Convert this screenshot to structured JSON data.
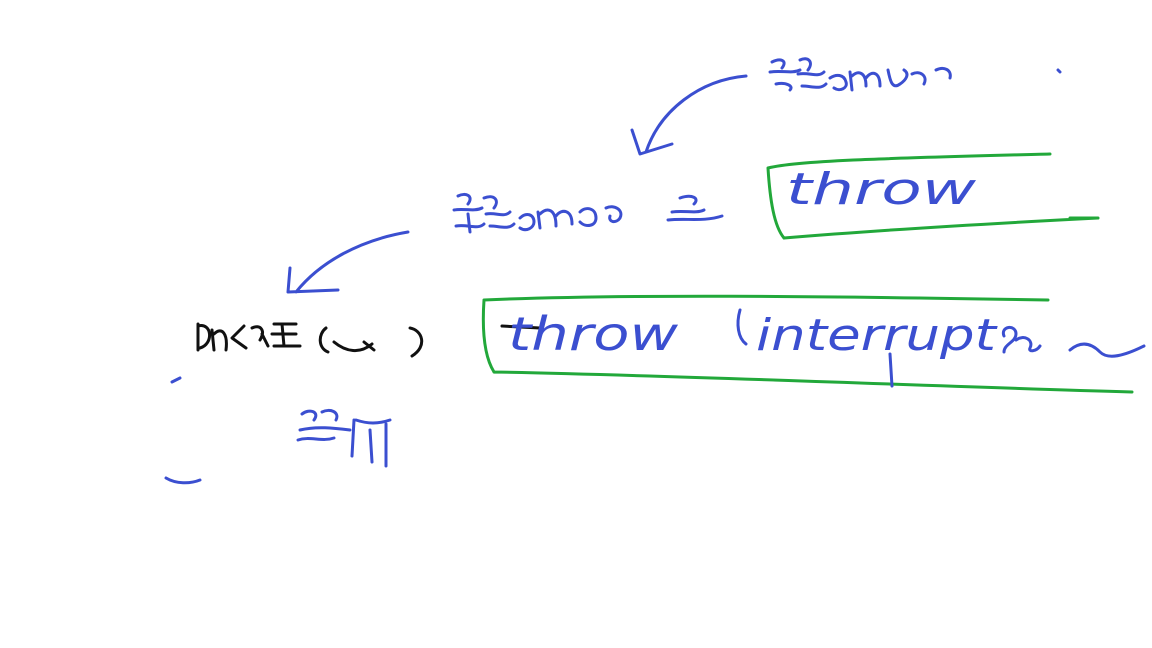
{
  "colors": {
    "blue_ink": "#3b4fd0",
    "green_ink": "#22a83a",
    "black_ink": "#111111",
    "background": "#ffffff"
  },
  "notes": {
    "scribble_top": "",
    "scribble_middle": "",
    "scribble_left": "",
    "scribble_bottom": "",
    "throw_label_top": "throw",
    "throw_label_bottom": "throw",
    "interrupt_text": "interrupt"
  }
}
